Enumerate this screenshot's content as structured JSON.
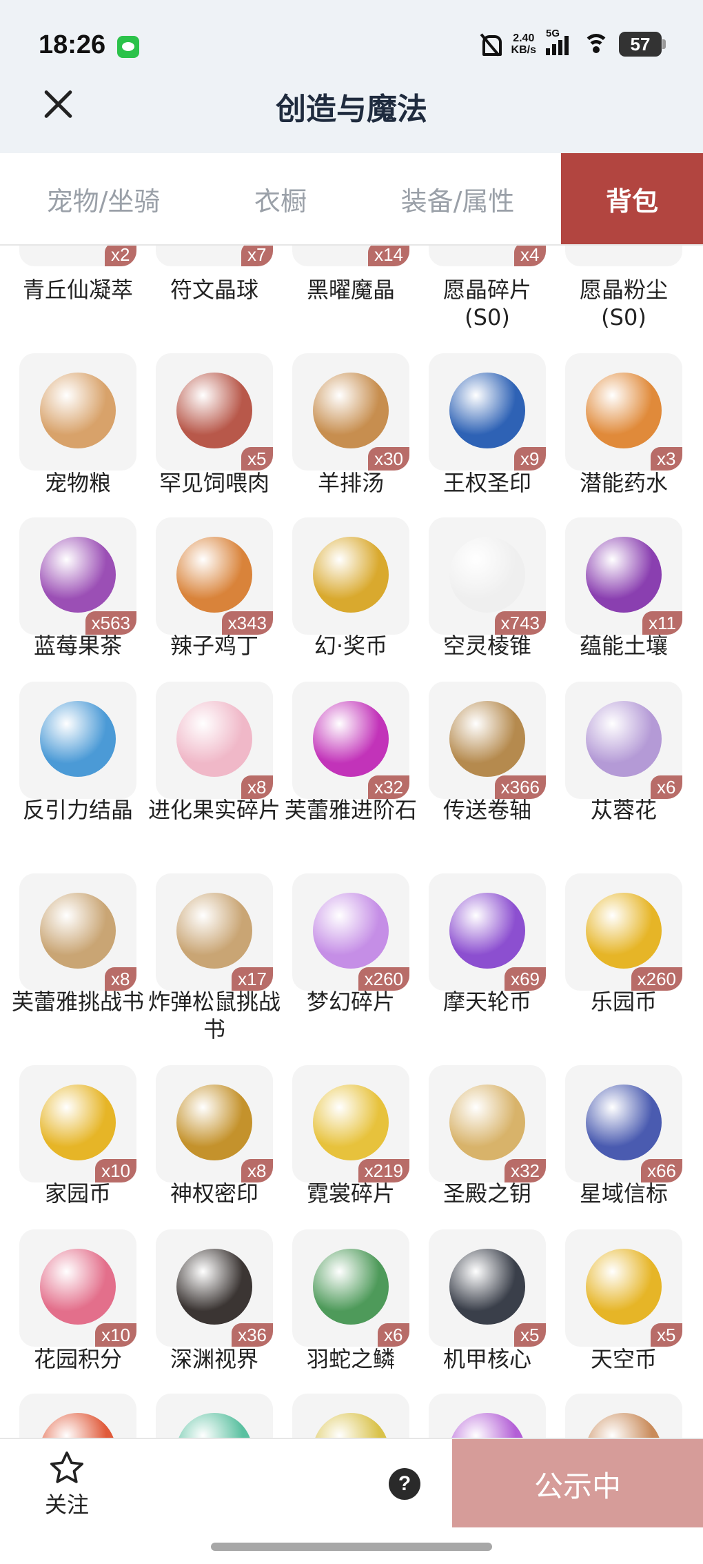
{
  "status_bar": {
    "time": "18:26",
    "speed_top": "2.40",
    "speed_bottom": "KB/s",
    "network": "5G",
    "battery": "57"
  },
  "header": {
    "title": "创造与魔法"
  },
  "tabs": [
    {
      "label": "宠物/坐骑",
      "active": false
    },
    {
      "label": "衣橱",
      "active": false
    },
    {
      "label": "装备/属性",
      "active": false
    },
    {
      "label": "背包",
      "active": true
    }
  ],
  "items": [
    {
      "name": "青丘仙凝萃",
      "qty": "x2",
      "color": "#7fb3e8"
    },
    {
      "name": "符文晶球",
      "qty": "x7",
      "color": "#6f8fe6"
    },
    {
      "name": "黑曜魔晶",
      "qty": "x14",
      "color": "#8ea7d8"
    },
    {
      "name": "愿晶碎片\n(S0)",
      "qty": "x4",
      "color": "#cfe3f5"
    },
    {
      "name": "愿晶粉尘\n(S0)",
      "qty": "",
      "color": "#e5e5e5"
    },
    {
      "name": "宠物粮",
      "qty": "",
      "color": "#d8a26a"
    },
    {
      "name": "罕见饲喂肉",
      "qty": "x5",
      "color": "#b8584a"
    },
    {
      "name": "羊排汤",
      "qty": "x30",
      "color": "#c78e4f"
    },
    {
      "name": "王权圣印",
      "qty": "x9",
      "color": "#2e62b5"
    },
    {
      "name": "潜能药水",
      "qty": "x3",
      "color": "#e08a3a"
    },
    {
      "name": "蓝莓果茶",
      "qty": "x563",
      "color": "#9b4fb5"
    },
    {
      "name": "辣子鸡丁",
      "qty": "x343",
      "color": "#d9833a"
    },
    {
      "name": "幻·奖币",
      "qty": "",
      "color": "#d9a92e"
    },
    {
      "name": "空灵棱锥",
      "qty": "x743",
      "color": "#efefef"
    },
    {
      "name": "蕴能土壤",
      "qty": "x11",
      "color": "#8a3fb0"
    },
    {
      "name": "反引力结晶",
      "qty": "",
      "color": "#4b9ad6"
    },
    {
      "name": "进化果实碎片",
      "qty": "x8",
      "color": "#f0b8c8"
    },
    {
      "name": "芙蕾雅进阶石",
      "qty": "x32",
      "color": "#c233b9"
    },
    {
      "name": "传送卷轴",
      "qty": "x366",
      "color": "#b58a4e"
    },
    {
      "name": "苁蓉花",
      "qty": "x6",
      "color": "#b49ad6"
    },
    {
      "name": "芙蕾雅挑战书",
      "qty": "x8",
      "color": "#c9a574"
    },
    {
      "name": "炸弹松鼠挑战书",
      "qty": "x17",
      "color": "#c9a574"
    },
    {
      "name": "梦幻碎片",
      "qty": "x260",
      "color": "#c58ee6"
    },
    {
      "name": "摩天轮币",
      "qty": "x69",
      "color": "#8c4fd0"
    },
    {
      "name": "乐园币",
      "qty": "x260",
      "color": "#e6b527"
    },
    {
      "name": "家园币",
      "qty": "x10",
      "color": "#e6b527"
    },
    {
      "name": "神权密印",
      "qty": "x8",
      "color": "#c4922c"
    },
    {
      "name": "霓裳碎片",
      "qty": "x219",
      "color": "#e7c23c"
    },
    {
      "name": "圣殿之钥",
      "qty": "x32",
      "color": "#d8b36a"
    },
    {
      "name": "星域信标",
      "qty": "x66",
      "color": "#4a5bb0"
    },
    {
      "name": "花园积分",
      "qty": "x10",
      "color": "#e36f8b"
    },
    {
      "name": "深渊视界",
      "qty": "x36",
      "color": "#3b3533"
    },
    {
      "name": "羽蛇之鳞",
      "qty": "x6",
      "color": "#4e9a5a"
    },
    {
      "name": "机甲核心",
      "qty": "x5",
      "color": "#3a3f4a"
    },
    {
      "name": "天空币",
      "qty": "x5",
      "color": "#e6b527"
    },
    {
      "name": "",
      "qty": "",
      "color": "#e05a3a"
    },
    {
      "name": "",
      "qty": "",
      "color": "#5ac0a0"
    },
    {
      "name": "",
      "qty": "",
      "color": "#d9c24a"
    },
    {
      "name": "",
      "qty": "",
      "color": "#b35fd6"
    },
    {
      "name": "",
      "qty": "",
      "color": "#c98b5a"
    }
  ],
  "bottom_bar": {
    "follow_label": "关注",
    "help": "?",
    "public_label": "公示中"
  }
}
